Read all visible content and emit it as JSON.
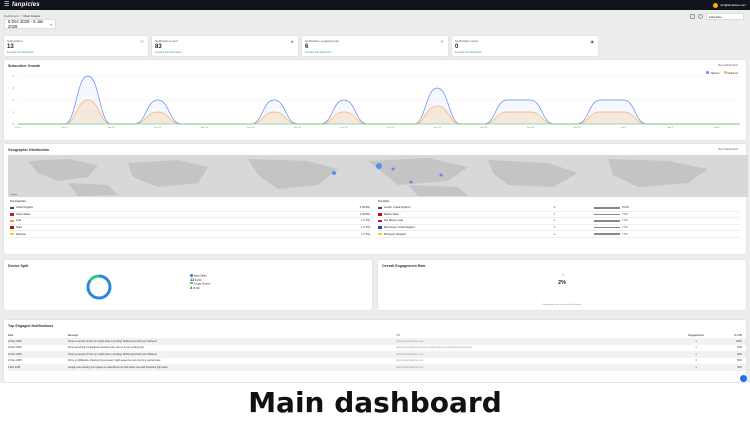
{
  "app": {
    "brand": "fanpicles",
    "user": "fan@fanpicles.com"
  },
  "breadcrumb": [
    "Dashboard",
    "/",
    "Main Details"
  ],
  "date_range": "6 Dec 2025 - 6 Jan 2026",
  "header_select": "Fanpicles",
  "stats": [
    {
      "label": "Subscribers",
      "value": "13",
      "sub": "Increase from last period",
      "icon": "users-icon"
    },
    {
      "label": "Notifications sent",
      "value": "83",
      "sub": "Increase from last period",
      "icon": "send-icon"
    },
    {
      "label": "Notification engagements",
      "value": "6",
      "sub": "Increase from last period",
      "icon": "click-icon"
    },
    {
      "label": "Notification views",
      "value": "0",
      "sub": "Increase from last period",
      "icon": "eye-icon"
    }
  ],
  "growth": {
    "title": "Subscriber Growth",
    "legend": [
      "Opted in",
      "Opted out"
    ],
    "colors": [
      "#5b8def",
      "#f6b26b"
    ],
    "filter_label": "View Subscribers"
  },
  "chart_data": {
    "type": "area",
    "x": [
      "Dec 6",
      "Dec 7",
      "Dec 8",
      "Dec 9",
      "Dec 10",
      "Dec 11",
      "Dec 12",
      "Dec 13",
      "Dec 14",
      "Dec 15",
      "Dec 16",
      "Dec 17",
      "Dec 18",
      "Dec 19",
      "Dec 20",
      "Dec 21",
      "Dec 22",
      "Dec 23",
      "Dec 24",
      "Dec 25",
      "Dec 26",
      "Dec 27",
      "Dec 28",
      "Dec 29",
      "Dec 30",
      "Dec 31",
      "Jan 1",
      "Jan 2",
      "Jan 3",
      "Jan 4",
      "Jan 5",
      "Jan 6"
    ],
    "series": [
      {
        "name": "Opted in",
        "values": [
          0,
          0,
          0,
          4,
          0,
          0,
          2,
          0,
          0,
          0,
          0,
          2,
          0,
          0,
          2,
          0,
          0,
          0,
          3,
          0,
          0,
          2,
          2,
          0,
          0,
          2,
          2,
          0,
          0,
          0,
          0,
          0
        ]
      },
      {
        "name": "Opted out",
        "values": [
          0,
          0,
          0,
          2,
          0,
          0,
          1,
          0,
          0,
          0,
          0,
          1,
          0,
          0,
          1,
          0,
          0,
          0,
          1.5,
          0,
          0,
          1,
          1,
          0,
          0,
          1,
          1,
          0,
          0,
          0,
          0,
          0
        ]
      }
    ],
    "ylim": [
      0,
      4
    ],
    "yticks": [
      "4",
      "3",
      "2",
      "1",
      "0"
    ]
  },
  "geo": {
    "title": "Geographic Distribution",
    "map_label": "Google",
    "filter_label": "View Subscribers",
    "countries_title": "Top Countries",
    "cities_title": "Top Cities",
    "countries": [
      {
        "name": "United Kingdom",
        "pct": "4 (30.8%)",
        "flag": "#2b4ea2"
      },
      {
        "name": "United States",
        "pct": "4 (30.8%)",
        "flag": "#b22234"
      },
      {
        "name": "India",
        "pct": "1 (7.7%)",
        "flag": "#ff9933"
      },
      {
        "name": "Spain",
        "pct": "1 (7.7%)",
        "flag": "#c60b1e"
      },
      {
        "name": "Romania",
        "pct": "1 (7.7%)",
        "flag": "#fcd116"
      }
    ],
    "cities": [
      {
        "name": "London, United Kingdom",
        "count": "2",
        "pct": "15.4%",
        "flag": "#2b4ea2"
      },
      {
        "name": "Madrid, Spain",
        "count": "1",
        "pct": "7.7%",
        "flag": "#c60b1e"
      },
      {
        "name": "Des Moines, Iowa",
        "count": "1",
        "pct": "7.7%",
        "flag": "#b22234"
      },
      {
        "name": "Manchester, United Kingdom",
        "count": "1",
        "pct": "7.7%",
        "flag": "#2b4ea2"
      },
      {
        "name": "Bucharest, Romania",
        "count": "1",
        "pct": "7.7%",
        "flag": "#fcd116"
      }
    ]
  },
  "device": {
    "title": "Device Split",
    "items": [
      {
        "label": "Apple Safari",
        "value": "11",
        "pct": "84.6%",
        "color": "#2e86de"
      },
      {
        "label": "Google Chrome",
        "value": "2",
        "pct": "15.4%",
        "color": "#2ecc71"
      }
    ],
    "fractions": [
      0.846,
      0.154
    ]
  },
  "engagement": {
    "title": "Overall Engagement Rate",
    "value": "2%",
    "note": "Engagement rate across all notifications"
  },
  "notifications": {
    "title": "Top Engaged Notifications",
    "headers": [
      "Date",
      "Message",
      "URL",
      "Engagements",
      "% CTR"
    ],
    "rows": [
      [
        "21 Dec 2025",
        "Here's a sample of how you might share a trending TikTok sound with your followers",
        "https://www.fanpicles.com",
        "1",
        "100%"
      ],
      [
        "19 Dec 2025",
        "We're launching our Fanpicles journal series, join us for an exciting post",
        "https://www.fanpicles.com/journal/launching-our-fanpicles-journal-series",
        "1",
        "50%"
      ],
      [
        "16 Dec 2025",
        "Here's a sample of how you might share a trending TikTok sound with your followers",
        "https://www.fanpicles.com",
        "1",
        "50%"
      ],
      [
        "13 Dec 2025",
        "We're on Wikipedia, showing how a creator might tease the next drop to a real fan base",
        "https://www.fanpicles.com",
        "1",
        "50%"
      ],
      [
        "9 Dec 2025",
        "Google now indexing your pages so subscribers can find what's new with Fanpicles right away",
        "https://www.fanpicles.com",
        "1",
        "50%"
      ]
    ]
  },
  "caption": "Main dashboard"
}
